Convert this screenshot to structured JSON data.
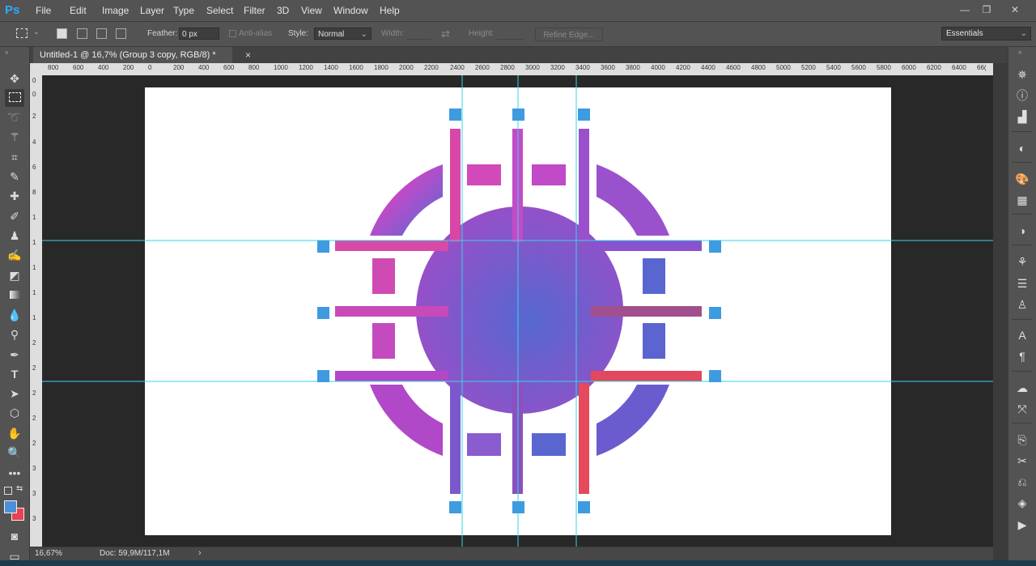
{
  "app": {
    "logo": "Ps"
  },
  "menu": [
    "File",
    "Edit",
    "Image",
    "Layer",
    "Type",
    "Select",
    "Filter",
    "3D",
    "View",
    "Window",
    "Help"
  ],
  "window_controls": [
    "—",
    "❐",
    "✕"
  ],
  "options": {
    "feather_label": "Feather:",
    "feather_value": "0 px",
    "antialias_label": "Anti-alias",
    "style_label": "Style:",
    "style_value": "Normal",
    "width_label": "Width:",
    "height_label": "Height:",
    "refine_edge": "Refine Edge...",
    "workspace": "Essentials"
  },
  "document": {
    "tab_title": "Untitled-1 @ 16,7% (Group 3 copy, RGB/8) *",
    "close": "×"
  },
  "ruler": {
    "top_labels": [
      "800",
      "600",
      "400",
      "200",
      "0",
      "200",
      "400",
      "600",
      "800",
      "1000",
      "1200",
      "1400",
      "1600",
      "1800",
      "2000",
      "2200",
      "2400",
      "2600",
      "2800",
      "3000",
      "3200",
      "3400",
      "3600",
      "3800",
      "4000",
      "4200",
      "4400",
      "4600",
      "4800",
      "5000",
      "5200",
      "5400",
      "5600",
      "5800",
      "6000",
      "6200",
      "6400",
      "66("
    ],
    "left_labels": [
      "0",
      "2",
      "4",
      "6",
      "8",
      "1",
      "1",
      "1",
      "1",
      "1",
      "2",
      "2",
      "2",
      "2",
      "2",
      "3",
      "3",
      "3",
      "3",
      "3",
      "4"
    ]
  },
  "status": {
    "zoom": "16,67%",
    "doc": "Doc: 59,9M/117,1M",
    "arrow": "›"
  },
  "tools": [
    "move-icon",
    "marquee-icon",
    "lasso-icon",
    "magic-wand-icon",
    "crop-icon",
    "eyedropper-icon",
    "healing-icon",
    "brush-icon",
    "stamp-icon",
    "history-brush-icon",
    "eraser-icon",
    "gradient-icon",
    "blur-icon",
    "dodge-icon",
    "pen-icon",
    "type-icon",
    "path-select-icon",
    "shape-icon",
    "hand-icon",
    "zoom-icon",
    "more-icon"
  ],
  "colors": {
    "foreground": "#4a90d9",
    "background": "#e8414f",
    "guide": "#33d6e8",
    "handle": "#3f9be0"
  }
}
